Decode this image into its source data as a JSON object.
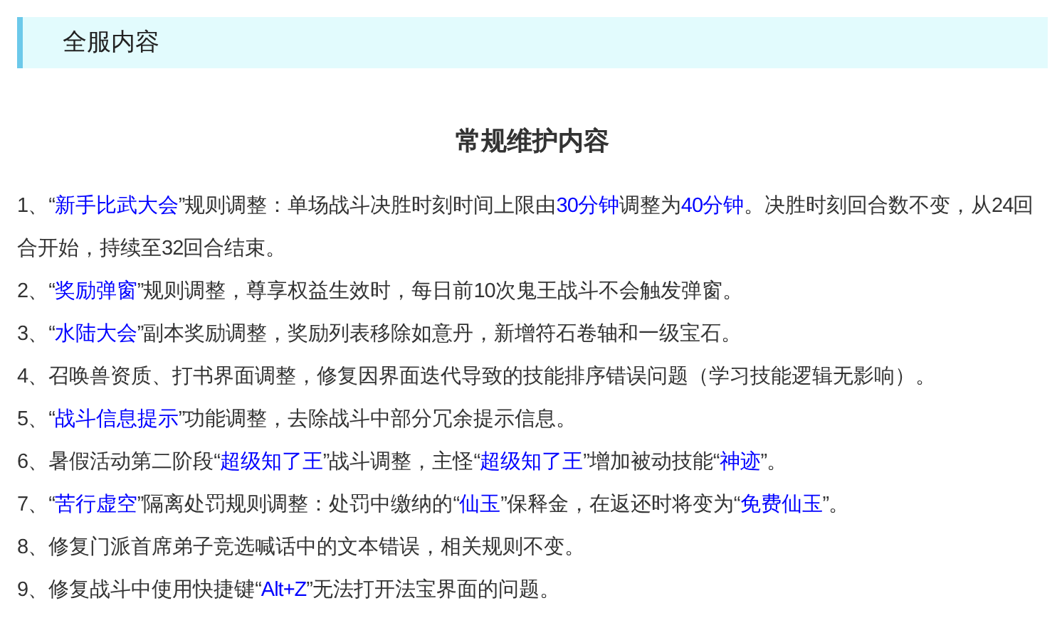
{
  "section_title": "全服内容",
  "heading": "常规维护内容",
  "items": [
    {
      "segments": [
        {
          "text": "1、“",
          "highlight": false
        },
        {
          "text": "新手比武大会",
          "highlight": true
        },
        {
          "text": "”规则调整：单场战斗决胜时刻时间上限由",
          "highlight": false
        },
        {
          "text": "30分钟",
          "highlight": true
        },
        {
          "text": "调整为",
          "highlight": false
        },
        {
          "text": "40分钟",
          "highlight": true
        },
        {
          "text": "。决胜时刻回合数不变，从24回合开始，持续至32回合结束。",
          "highlight": false
        }
      ]
    },
    {
      "segments": [
        {
          "text": "2、“",
          "highlight": false
        },
        {
          "text": "奖励弹窗",
          "highlight": true
        },
        {
          "text": "”规则调整，尊享权益生效时，每日前10次鬼王战斗不会触发弹窗。",
          "highlight": false
        }
      ]
    },
    {
      "segments": [
        {
          "text": "3、“",
          "highlight": false
        },
        {
          "text": "水陆大会",
          "highlight": true
        },
        {
          "text": "”副本奖励调整，奖励列表移除如意丹，新增符石卷轴和一级宝石。",
          "highlight": false
        }
      ]
    },
    {
      "segments": [
        {
          "text": "4、召唤兽资质、打书界面调整，修复因界面迭代导致的技能排序错误问题（学习技能逻辑无影响）。",
          "highlight": false
        }
      ]
    },
    {
      "segments": [
        {
          "text": "5、“",
          "highlight": false
        },
        {
          "text": "战斗信息提示",
          "highlight": true
        },
        {
          "text": "”功能调整，去除战斗中部分冗余提示信息。",
          "highlight": false
        }
      ]
    },
    {
      "segments": [
        {
          "text": "6、暑假活动第二阶段“",
          "highlight": false
        },
        {
          "text": "超级知了王",
          "highlight": true
        },
        {
          "text": "”战斗调整，主怪“",
          "highlight": false
        },
        {
          "text": "超级知了王",
          "highlight": true
        },
        {
          "text": "”增加被动技能“",
          "highlight": false
        },
        {
          "text": "神迹",
          "highlight": true
        },
        {
          "text": "”。",
          "highlight": false
        }
      ]
    },
    {
      "segments": [
        {
          "text": "7、“",
          "highlight": false
        },
        {
          "text": "苦行虚空",
          "highlight": true
        },
        {
          "text": "”隔离处罚规则调整：处罚中缴纳的“",
          "highlight": false
        },
        {
          "text": "仙玉",
          "highlight": true
        },
        {
          "text": "”保释金，在返还时将变为“",
          "highlight": false
        },
        {
          "text": "免费仙玉",
          "highlight": true
        },
        {
          "text": "”。",
          "highlight": false
        }
      ]
    },
    {
      "segments": [
        {
          "text": "8、修复门派首席弟子竞选喊话中的文本错误，相关规则不变。",
          "highlight": false
        }
      ]
    },
    {
      "segments": [
        {
          "text": "9、修复战斗中使用快捷键“",
          "highlight": false
        },
        {
          "text": "Alt+Z",
          "highlight": true
        },
        {
          "text": "”无法打开法宝界面的问题。",
          "highlight": false
        }
      ]
    }
  ]
}
